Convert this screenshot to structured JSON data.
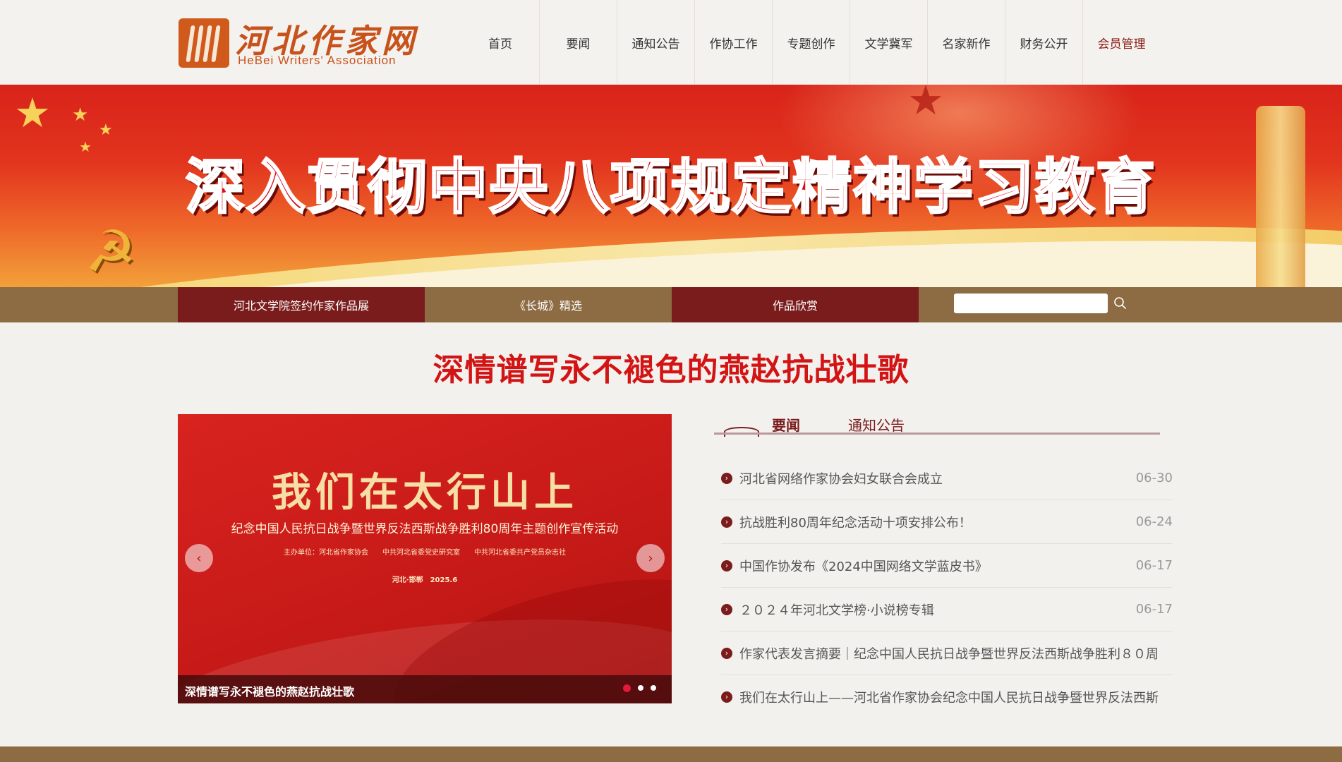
{
  "header": {
    "logo_cn": "河北作家网",
    "logo_en": "HeBei Writers' Association",
    "nav": [
      {
        "label": "首页"
      },
      {
        "label": "要闻"
      },
      {
        "label": "通知公告"
      },
      {
        "label": "作协工作"
      },
      {
        "label": "专题创作"
      },
      {
        "label": "文学冀军"
      },
      {
        "label": "名家新作"
      },
      {
        "label": "财务公开"
      },
      {
        "label": "会员管理"
      }
    ]
  },
  "banner": {
    "title": "深入贯彻中央八项规定精神学习教育"
  },
  "subnav": {
    "items": [
      {
        "label": "河北文学院签约作家作品展"
      },
      {
        "label": "《长城》精选"
      },
      {
        "label": "作品欣赏"
      }
    ],
    "search_placeholder": "",
    "search_icon": "search-icon"
  },
  "headline": "深情谱写永不褪色的燕赵抗战壮歌",
  "slider": {
    "slide_title": "我们在太行山上",
    "slide_subtitle": "纪念中国人民抗日战争暨世界反法西斯战争胜利80周年主题创作宣传活动",
    "slide_org": "主办单位：河北省作家协会　　中共河北省委党史研究室　　中共河北省委共产党员杂志社",
    "slide_date": "河北·邯郸　2025.6",
    "caption": "深情谱写永不褪色的燕赵抗战壮歌",
    "prev_icon": "chevron-left-icon",
    "next_icon": "chevron-right-icon",
    "dots": 3,
    "active_dot": 0
  },
  "news": {
    "tabs": [
      {
        "label": "要闻",
        "active": true
      },
      {
        "label": "通知公告",
        "active": false
      }
    ],
    "items": [
      {
        "title": "河北省网络作家协会妇女联合会成立",
        "date": "06-30"
      },
      {
        "title": "抗战胜利80周年纪念活动十项安排公布！",
        "date": "06-24"
      },
      {
        "title": "中国作协发布《2024中国网络文学蓝皮书》",
        "date": "06-17"
      },
      {
        "title": "２０２４年河北文学榜·小说榜专辑",
        "date": "06-17"
      },
      {
        "title": "作家代表发言摘要｜纪念中国人民抗日战争暨世界反法西斯战争胜利８０周",
        "date": ""
      },
      {
        "title": "我们在太行山上——河北省作家协会纪念中国人民抗日战争暨世界反法西斯",
        "date": ""
      }
    ]
  },
  "colors": {
    "accent_dark_red": "#7a1c1c",
    "headline_red": "#d31414",
    "brown_bar": "#8d6b43",
    "logo_orange": "#c8521b"
  }
}
